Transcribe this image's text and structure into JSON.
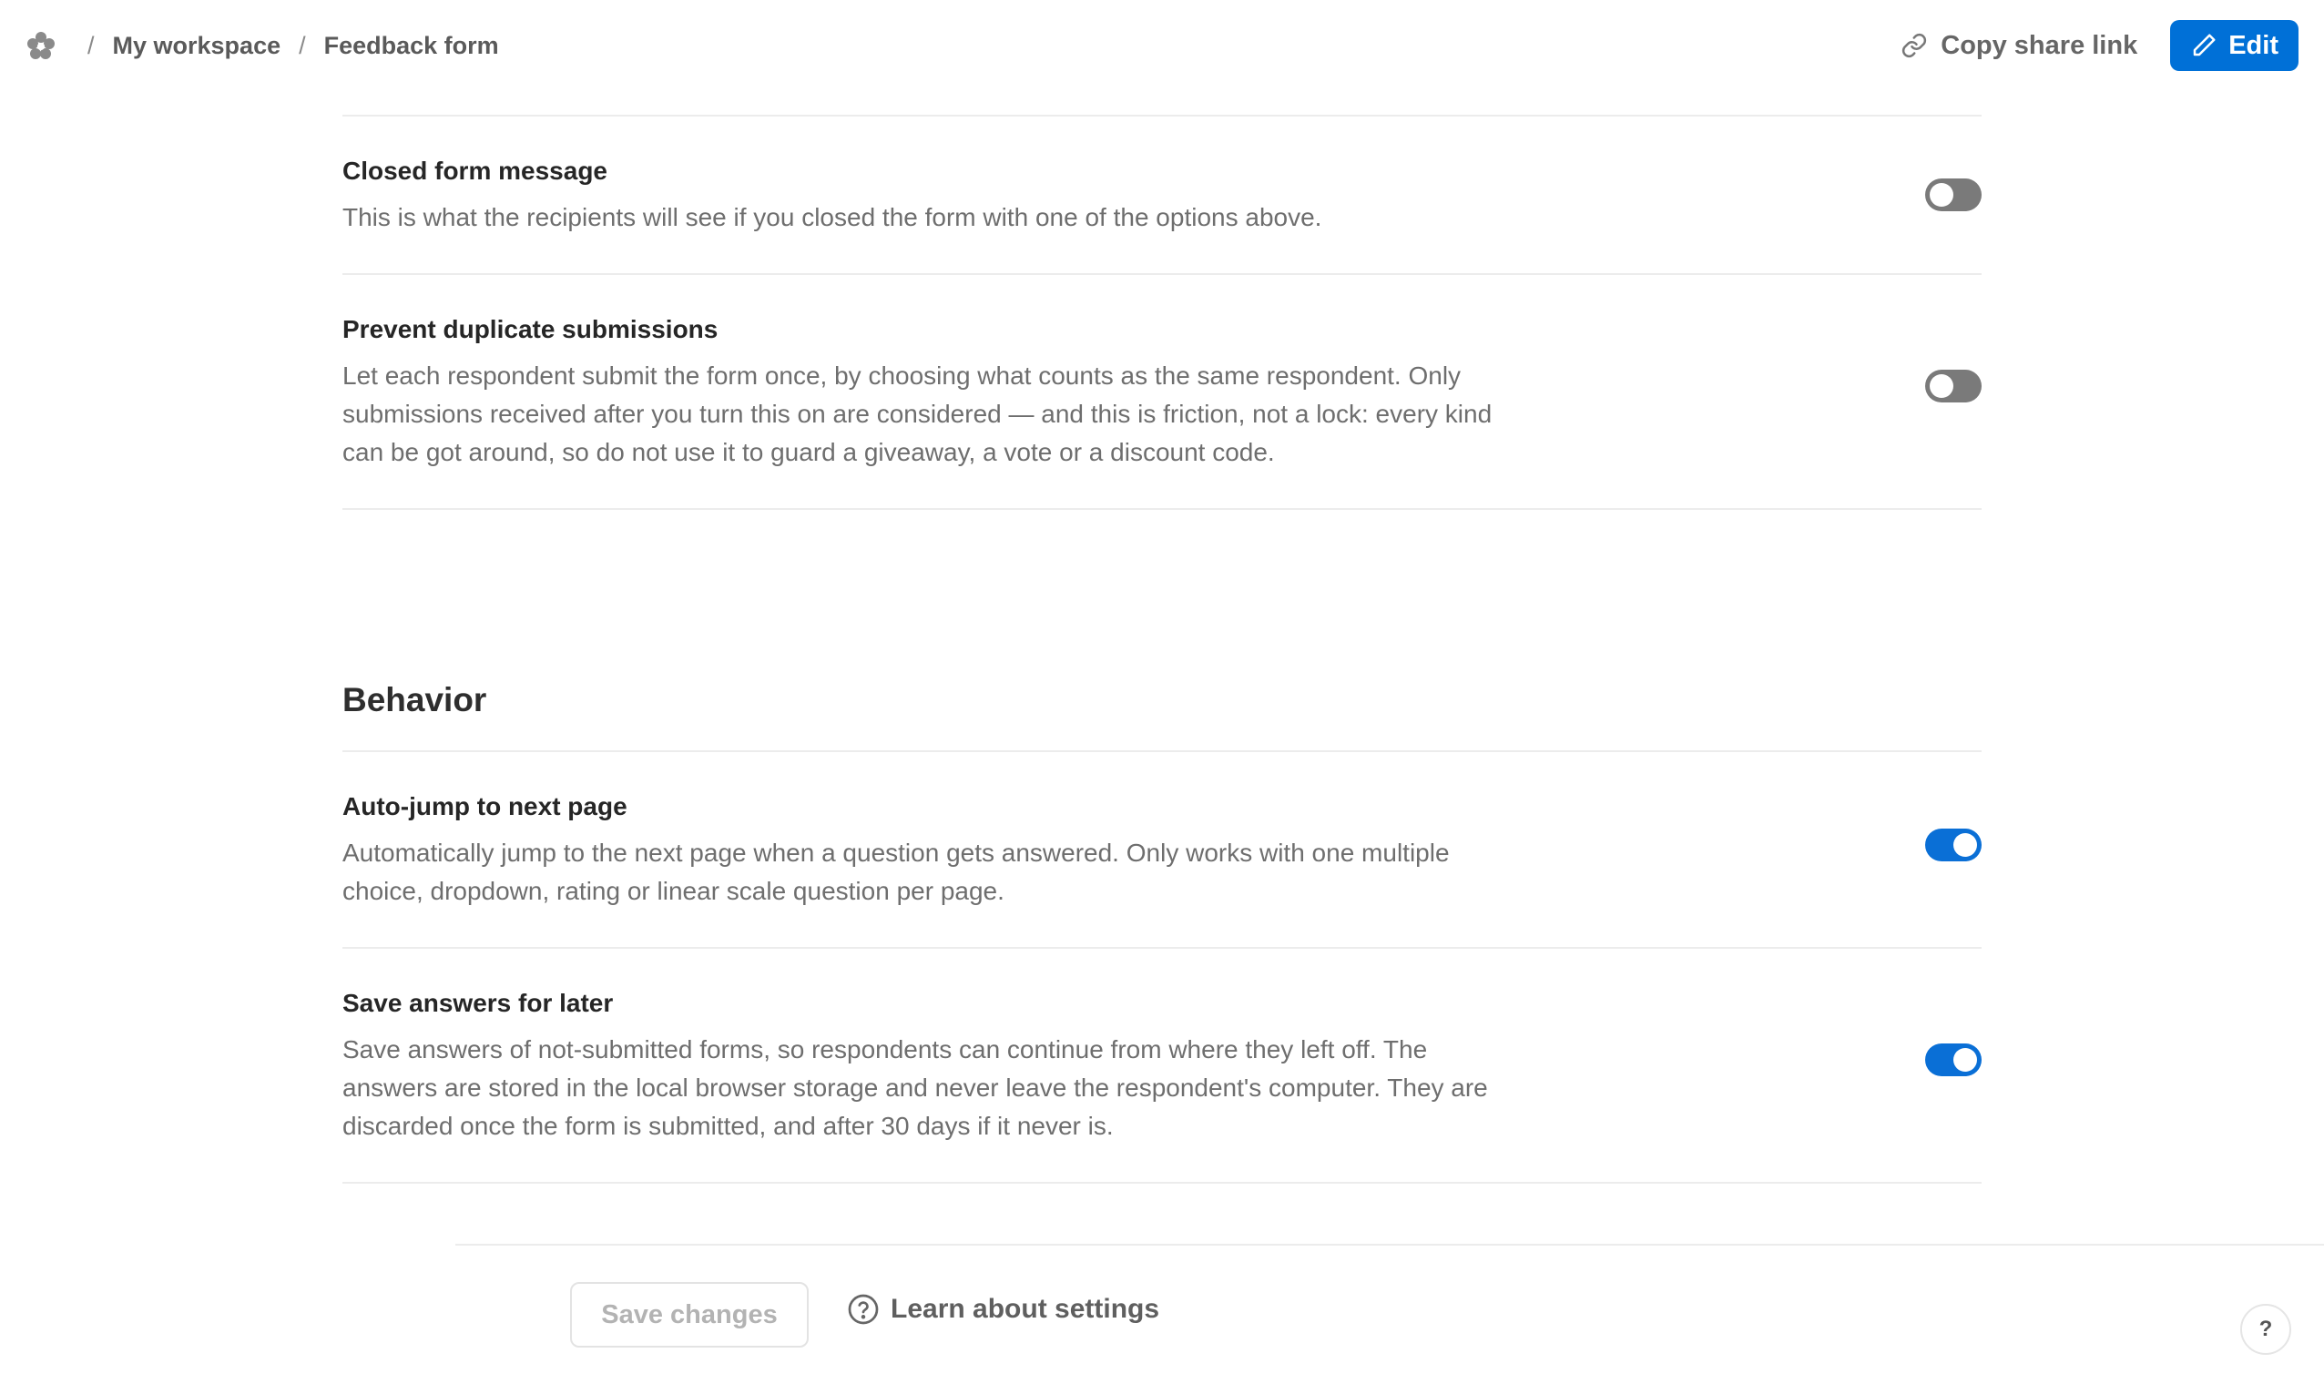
{
  "breadcrumb": {
    "logo_icon": "flower-icon",
    "separator": "/",
    "items": [
      "My workspace",
      "Feedback form"
    ]
  },
  "header": {
    "share_label": "Copy share link",
    "share_icon": "link-icon",
    "edit_label": "Edit",
    "edit_icon": "pencil-icon",
    "accent_color": "#0070d7"
  },
  "settings": {
    "closed_message": {
      "title": "Closed form message",
      "description": "This is what the recipients will see if you closed the form with one of the options above.",
      "enabled": false
    },
    "prevent_duplicates": {
      "title": "Prevent duplicate submissions",
      "description": "Let each respondent submit the form once, by choosing what counts as the same respondent. Only submissions received after you turn this on are considered — and this is friction, not a lock: every kind can be got around, so do not use it to guard a giveaway, a vote or a discount code.",
      "enabled": false
    }
  },
  "behavior": {
    "section_title": "Behavior",
    "auto_jump": {
      "title": "Auto-jump to next page",
      "description": "Automatically jump to the next page when a question gets answered. Only works with one multiple choice, dropdown, rating or linear scale question per page.",
      "enabled": true
    },
    "save_for_later": {
      "title": "Save answers for later",
      "description": "Save answers of not-submitted forms, so respondents can continue from where they left off. The answers are stored in the local browser storage and never leave the respondent's computer. They are discarded once the form is submitted, and after 30 days if it never is.",
      "enabled": true
    }
  },
  "footer": {
    "save_label": "Save changes",
    "learn_label": "Learn about settings",
    "learn_icon": "question-circle-icon",
    "help_label": "?"
  }
}
